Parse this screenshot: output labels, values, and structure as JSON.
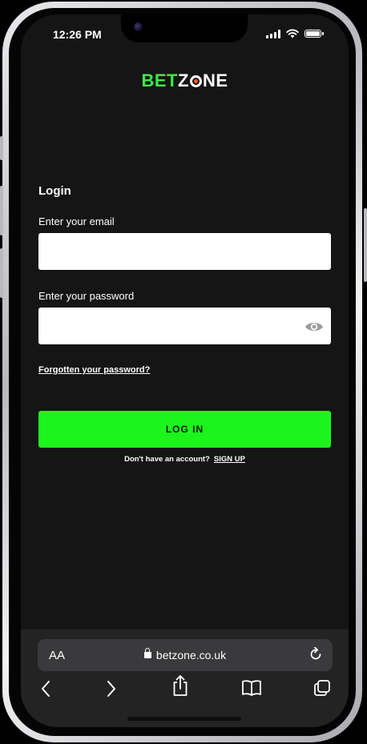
{
  "status_bar": {
    "time": "12:26 PM"
  },
  "brand": {
    "part1": "BET",
    "part2": "Z",
    "part3": "NE",
    "accent_green": "#3ee84a",
    "accent_orange": "#ff5a1f"
  },
  "login": {
    "title": "Login",
    "email_label": "Enter your email",
    "email_value": "",
    "email_placeholder": "",
    "password_label": "Enter your password",
    "password_value": "",
    "password_placeholder": "",
    "forgot_link": "Forgotten your password?",
    "submit_label": "LOG IN",
    "no_account_text": "Don't have an account?",
    "signup_link": "SIGN UP",
    "button_color": "#1cf51c"
  },
  "browser": {
    "text_size_label": "AA",
    "url": "betzone.co.uk",
    "nav_icons": [
      "back-icon",
      "forward-icon",
      "share-icon",
      "bookmarks-icon",
      "tabs-icon"
    ]
  }
}
